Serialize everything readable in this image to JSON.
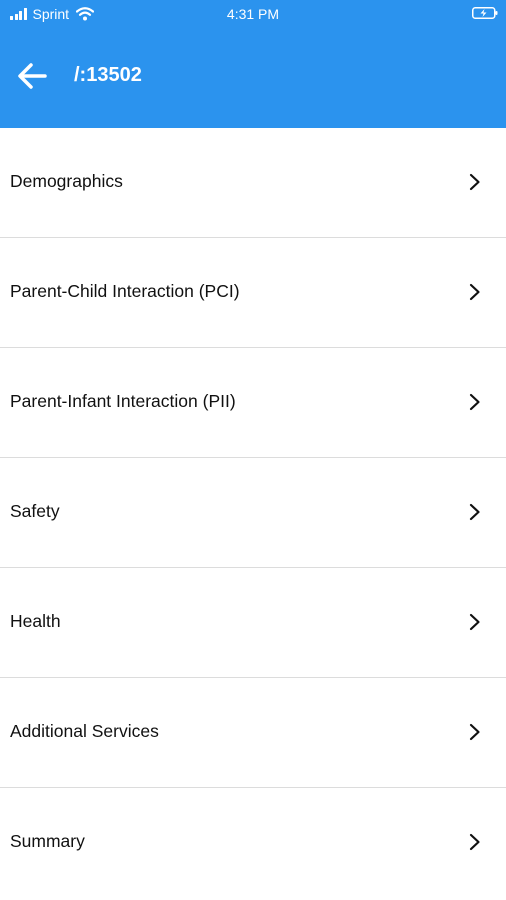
{
  "status_bar": {
    "carrier": "Sprint",
    "time": "4:31 PM"
  },
  "nav": {
    "title": "/:13502",
    "back_icon": "arrow-left-icon"
  },
  "menu": {
    "items": [
      {
        "label": "Demographics"
      },
      {
        "label": "Parent-Child Interaction (PCI)"
      },
      {
        "label": "Parent-Infant Interaction (PII)"
      },
      {
        "label": "Safety"
      },
      {
        "label": "Health"
      },
      {
        "label": "Additional Services"
      },
      {
        "label": "Summary"
      }
    ],
    "chevron_icon": "chevron-right-icon"
  },
  "colors": {
    "header_bg": "#2b93ee",
    "divider": "#dcdcdc",
    "text": "#111111"
  }
}
